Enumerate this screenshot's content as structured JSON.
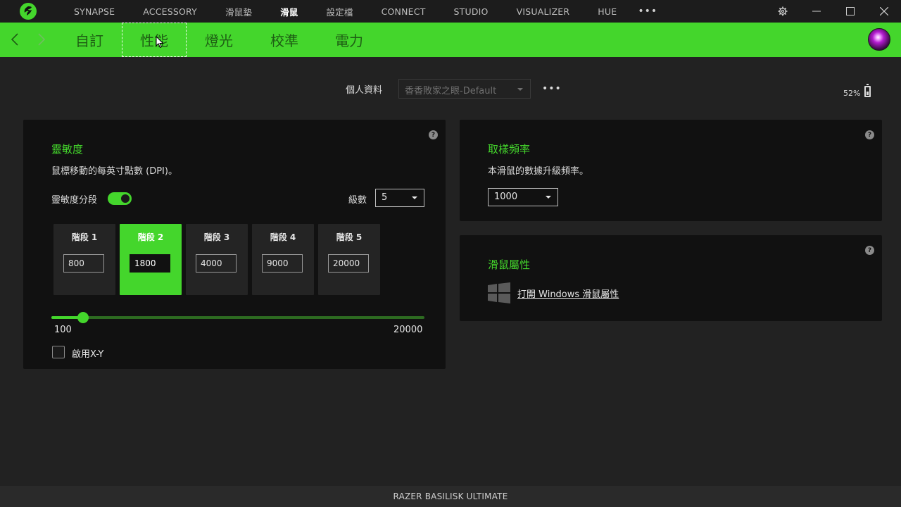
{
  "top_nav": {
    "items": [
      "SYNAPSE",
      "ACCESSORY",
      "滑鼠墊",
      "滑鼠",
      "設定檔",
      "CONNECT",
      "STUDIO",
      "VISUALIZER",
      "HUE"
    ],
    "active_index": 3,
    "more_label": "•••"
  },
  "sub_nav": {
    "tabs": [
      "自訂",
      "性能",
      "燈光",
      "校準",
      "電力"
    ],
    "active_index": 1
  },
  "profile": {
    "label": "個人資料",
    "value": "香香敗家之眼-Default",
    "more_label": "•••"
  },
  "battery": {
    "percent_label": "52%",
    "level": 0.52
  },
  "sensitivity": {
    "title": "靈敏度",
    "description": "鼠標移動的每英寸點數 (DPI)。",
    "stages_label": "靈敏度分段",
    "stages_enabled": true,
    "levels_label": "級數",
    "levels_value": "5",
    "stages": [
      {
        "label": "階段 1",
        "value": "800"
      },
      {
        "label": "階段 2",
        "value": "1800"
      },
      {
        "label": "階段 3",
        "value": "4000"
      },
      {
        "label": "階段 4",
        "value": "9000"
      },
      {
        "label": "階段 5",
        "value": "20000"
      }
    ],
    "active_stage": 1,
    "slider_min": "100",
    "slider_max": "20000",
    "slider_value": 1800,
    "xy_label": "啟用X-Y",
    "xy_enabled": false
  },
  "polling": {
    "title": "取樣頻率",
    "description": "本滑鼠的數據升級頻率。",
    "value": "1000"
  },
  "mouse_props": {
    "title": "滑鼠屬性",
    "link_label": "打開 Windows 滑鼠屬性"
  },
  "help_label": "?",
  "footer": {
    "device_name": "RAZER BASILISK ULTIMATE"
  },
  "colors": {
    "accent": "#44d62c",
    "panel": "#111111",
    "background": "#222222"
  }
}
